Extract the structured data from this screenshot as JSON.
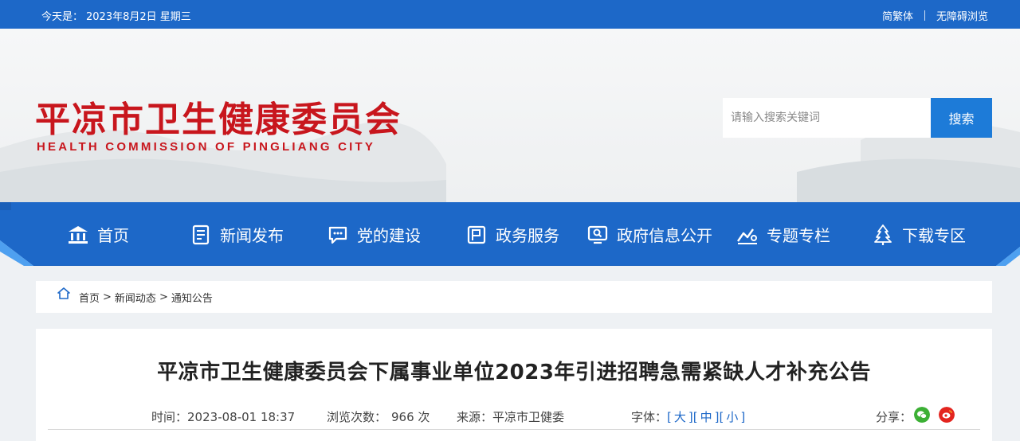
{
  "topbar": {
    "date_label": "今天是：",
    "date_value": "2023年8月2日 星期三",
    "traditional_link": "简繁体",
    "accessible_link": "无障碍浏览"
  },
  "banner": {
    "title_cn": "平凉市卫生健康委员会",
    "title_en": "HEALTH COMMISSION OF PINGLIANG CITY",
    "search_placeholder": "请输入搜索关键词",
    "search_button": "搜索"
  },
  "nav": {
    "items": [
      {
        "label": "首页",
        "icon": "bank-icon"
      },
      {
        "label": "新闻发布",
        "icon": "document-icon"
      },
      {
        "label": "党的建设",
        "icon": "chat-icon"
      },
      {
        "label": "政务服务",
        "icon": "board-icon"
      },
      {
        "label": "政府信息公开",
        "icon": "monitor-search-icon"
      },
      {
        "label": "专题专栏",
        "icon": "chart-icon"
      },
      {
        "label": "下载专区",
        "icon": "tree-icon"
      }
    ],
    "color": "#1d68c8"
  },
  "breadcrumb": {
    "home": "首页",
    "level1": "新闻动态",
    "level2": "通知公告",
    "separator": ">"
  },
  "article": {
    "title": "平凉市卫生健康委员会下属事业单位2023年引进招聘急需紧缺人才补充公告",
    "time_label": "时间：",
    "time_value": "2023-08-01 18:37",
    "views_label": "浏览次数：",
    "views_value": "966 次",
    "source_label": "来源：",
    "source_value": "平凉市卫健委",
    "font_label": "字体：",
    "font_large": "大",
    "font_medium": "中",
    "font_small": "小",
    "share_label": "分享："
  }
}
